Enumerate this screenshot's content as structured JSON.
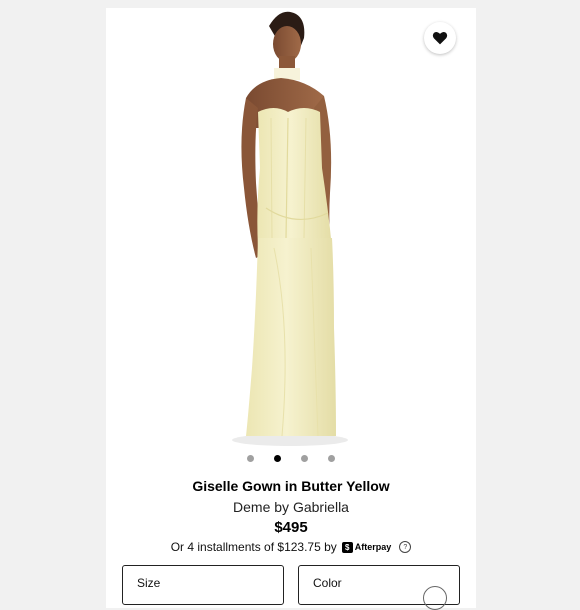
{
  "product": {
    "title": "Giselle Gown in Butter Yellow",
    "brand": "Deme by Gabriella",
    "price": "$495",
    "installments_text": "Or 4 installments of $123.75 by",
    "afterpay_label": "Afterpay",
    "help_symbol": "?",
    "gown_color": "#f3efc4",
    "favorite_icon": "heart-icon"
  },
  "gallery": {
    "dot_count": 4,
    "active_index": 1
  },
  "selectors": {
    "size_label": "Size",
    "color_label": "Color"
  }
}
